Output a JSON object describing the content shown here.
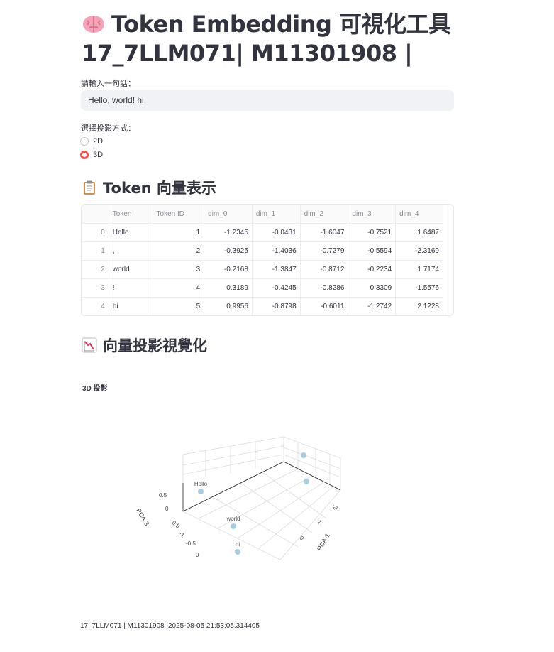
{
  "title_line1": "Token Embedding 可視化工具",
  "title_line2": "17_7LLM071| M11301908 |",
  "input_label": "請輸入一句話：",
  "input_value": "Hello, world! hi",
  "projection_label": "選擇投影方式：",
  "projection_options": [
    {
      "label": "2D",
      "selected": false
    },
    {
      "label": "3D",
      "selected": true
    }
  ],
  "section_vectors": "Token 向量表示",
  "table": {
    "headers": [
      "",
      "Token",
      "Token ID",
      "dim_0",
      "dim_1",
      "dim_2",
      "dim_3",
      "dim_4"
    ],
    "rows": [
      [
        "0",
        "Hello",
        "1",
        "-1.2345",
        "-0.0431",
        "-1.6047",
        "-0.7521",
        "1.6487"
      ],
      [
        "1",
        ",",
        "2",
        "-0.3925",
        "-1.4036",
        "-0.7279",
        "-0.5594",
        "-2.3169"
      ],
      [
        "2",
        "world",
        "3",
        "-0.2168",
        "-1.3847",
        "-0.8712",
        "-0.2234",
        "1.7174"
      ],
      [
        "3",
        "!",
        "4",
        "0.3189",
        "-0.4245",
        "-0.8286",
        "0.3309",
        "-1.5576"
      ],
      [
        "4",
        "hi",
        "5",
        "0.9956",
        "-0.8798",
        "-0.6011",
        "-1.2742",
        "2.1228"
      ]
    ]
  },
  "section_plot": "向量投影視覺化",
  "chart_data": {
    "type": "scatter",
    "title": "3D 投影",
    "axis_labels": {
      "x": "PCA-1",
      "z": "PCA-3"
    },
    "x_ticks": [
      "-2",
      "-1",
      "0"
    ],
    "z_ticks": [
      "0.5",
      "0",
      "-0.5",
      "-1",
      "-0.5",
      "0"
    ],
    "points": [
      {
        "label": "Hello"
      },
      {
        "label": "world"
      },
      {
        "label": "hi"
      },
      {
        "label": ""
      },
      {
        "label": ""
      }
    ],
    "marker_color": "#a6cee3"
  },
  "footer": "17_7LLM071 | M11301908 |2025-08-05 21:53:05.314405",
  "colors": {
    "accent": "#ff4b4b",
    "input_bg": "#f0f2f6",
    "marker": "#a6cee3"
  }
}
